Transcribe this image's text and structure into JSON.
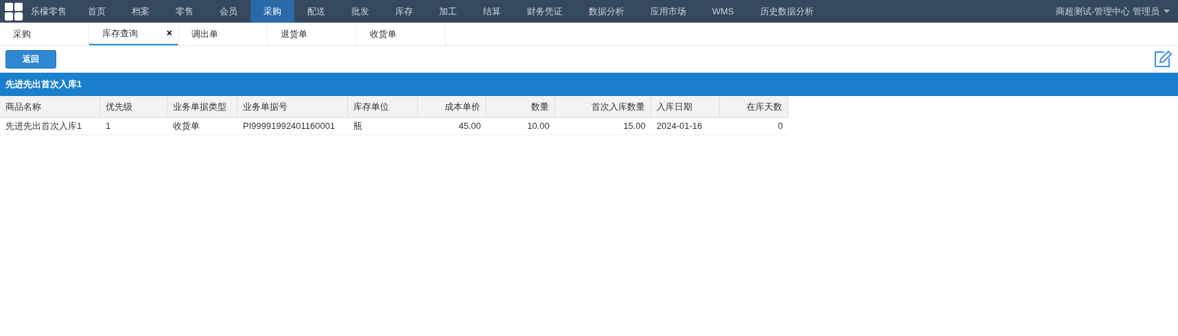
{
  "nav": {
    "brand": "乐檬零售",
    "items": [
      {
        "label": "首页",
        "selected": false
      },
      {
        "label": "档案",
        "selected": false
      },
      {
        "label": "零售",
        "selected": false
      },
      {
        "label": "会员",
        "selected": false
      },
      {
        "label": "采购",
        "selected": true
      },
      {
        "label": "配送",
        "selected": false
      },
      {
        "label": "批发",
        "selected": false
      },
      {
        "label": "库存",
        "selected": false
      },
      {
        "label": "加工",
        "selected": false
      },
      {
        "label": "结算",
        "selected": false
      },
      {
        "label": "财务凭证",
        "selected": false
      },
      {
        "label": "数据分析",
        "selected": false
      },
      {
        "label": "应用市场",
        "selected": false
      },
      {
        "label": "WMS",
        "selected": false
      },
      {
        "label": "历史数据分析",
        "selected": false
      }
    ],
    "user": "商超测试-管理中心 管理员"
  },
  "tabs": [
    {
      "label": "采购",
      "selected": false
    },
    {
      "label": "库存查询",
      "selected": true,
      "close": "×"
    },
    {
      "label": "调出单",
      "selected": false
    },
    {
      "label": "退货单",
      "selected": false
    },
    {
      "label": "收货单",
      "selected": false
    }
  ],
  "back_button": "返回",
  "panel_title": "先进先出首次入库1",
  "table": {
    "columns": [
      {
        "label": "商品名称",
        "kind": "text"
      },
      {
        "label": "优先级",
        "kind": "text"
      },
      {
        "label": "业务单据类型",
        "kind": "text"
      },
      {
        "label": "业务单据号",
        "kind": "text"
      },
      {
        "label": "库存单位",
        "kind": "text"
      },
      {
        "label": "成本单价",
        "kind": "number"
      },
      {
        "label": "数量",
        "kind": "number"
      },
      {
        "label": "首次入库数量",
        "kind": "number"
      },
      {
        "label": "入库日期",
        "kind": "text"
      },
      {
        "label": "在库天数",
        "kind": "number"
      }
    ],
    "rows": [
      [
        "先进先出首次入库1",
        "1",
        "收货单",
        "PI99991992401160001",
        "瓶",
        "45.00",
        "10.00",
        "15.00",
        "2024-01-16",
        "0"
      ]
    ]
  }
}
